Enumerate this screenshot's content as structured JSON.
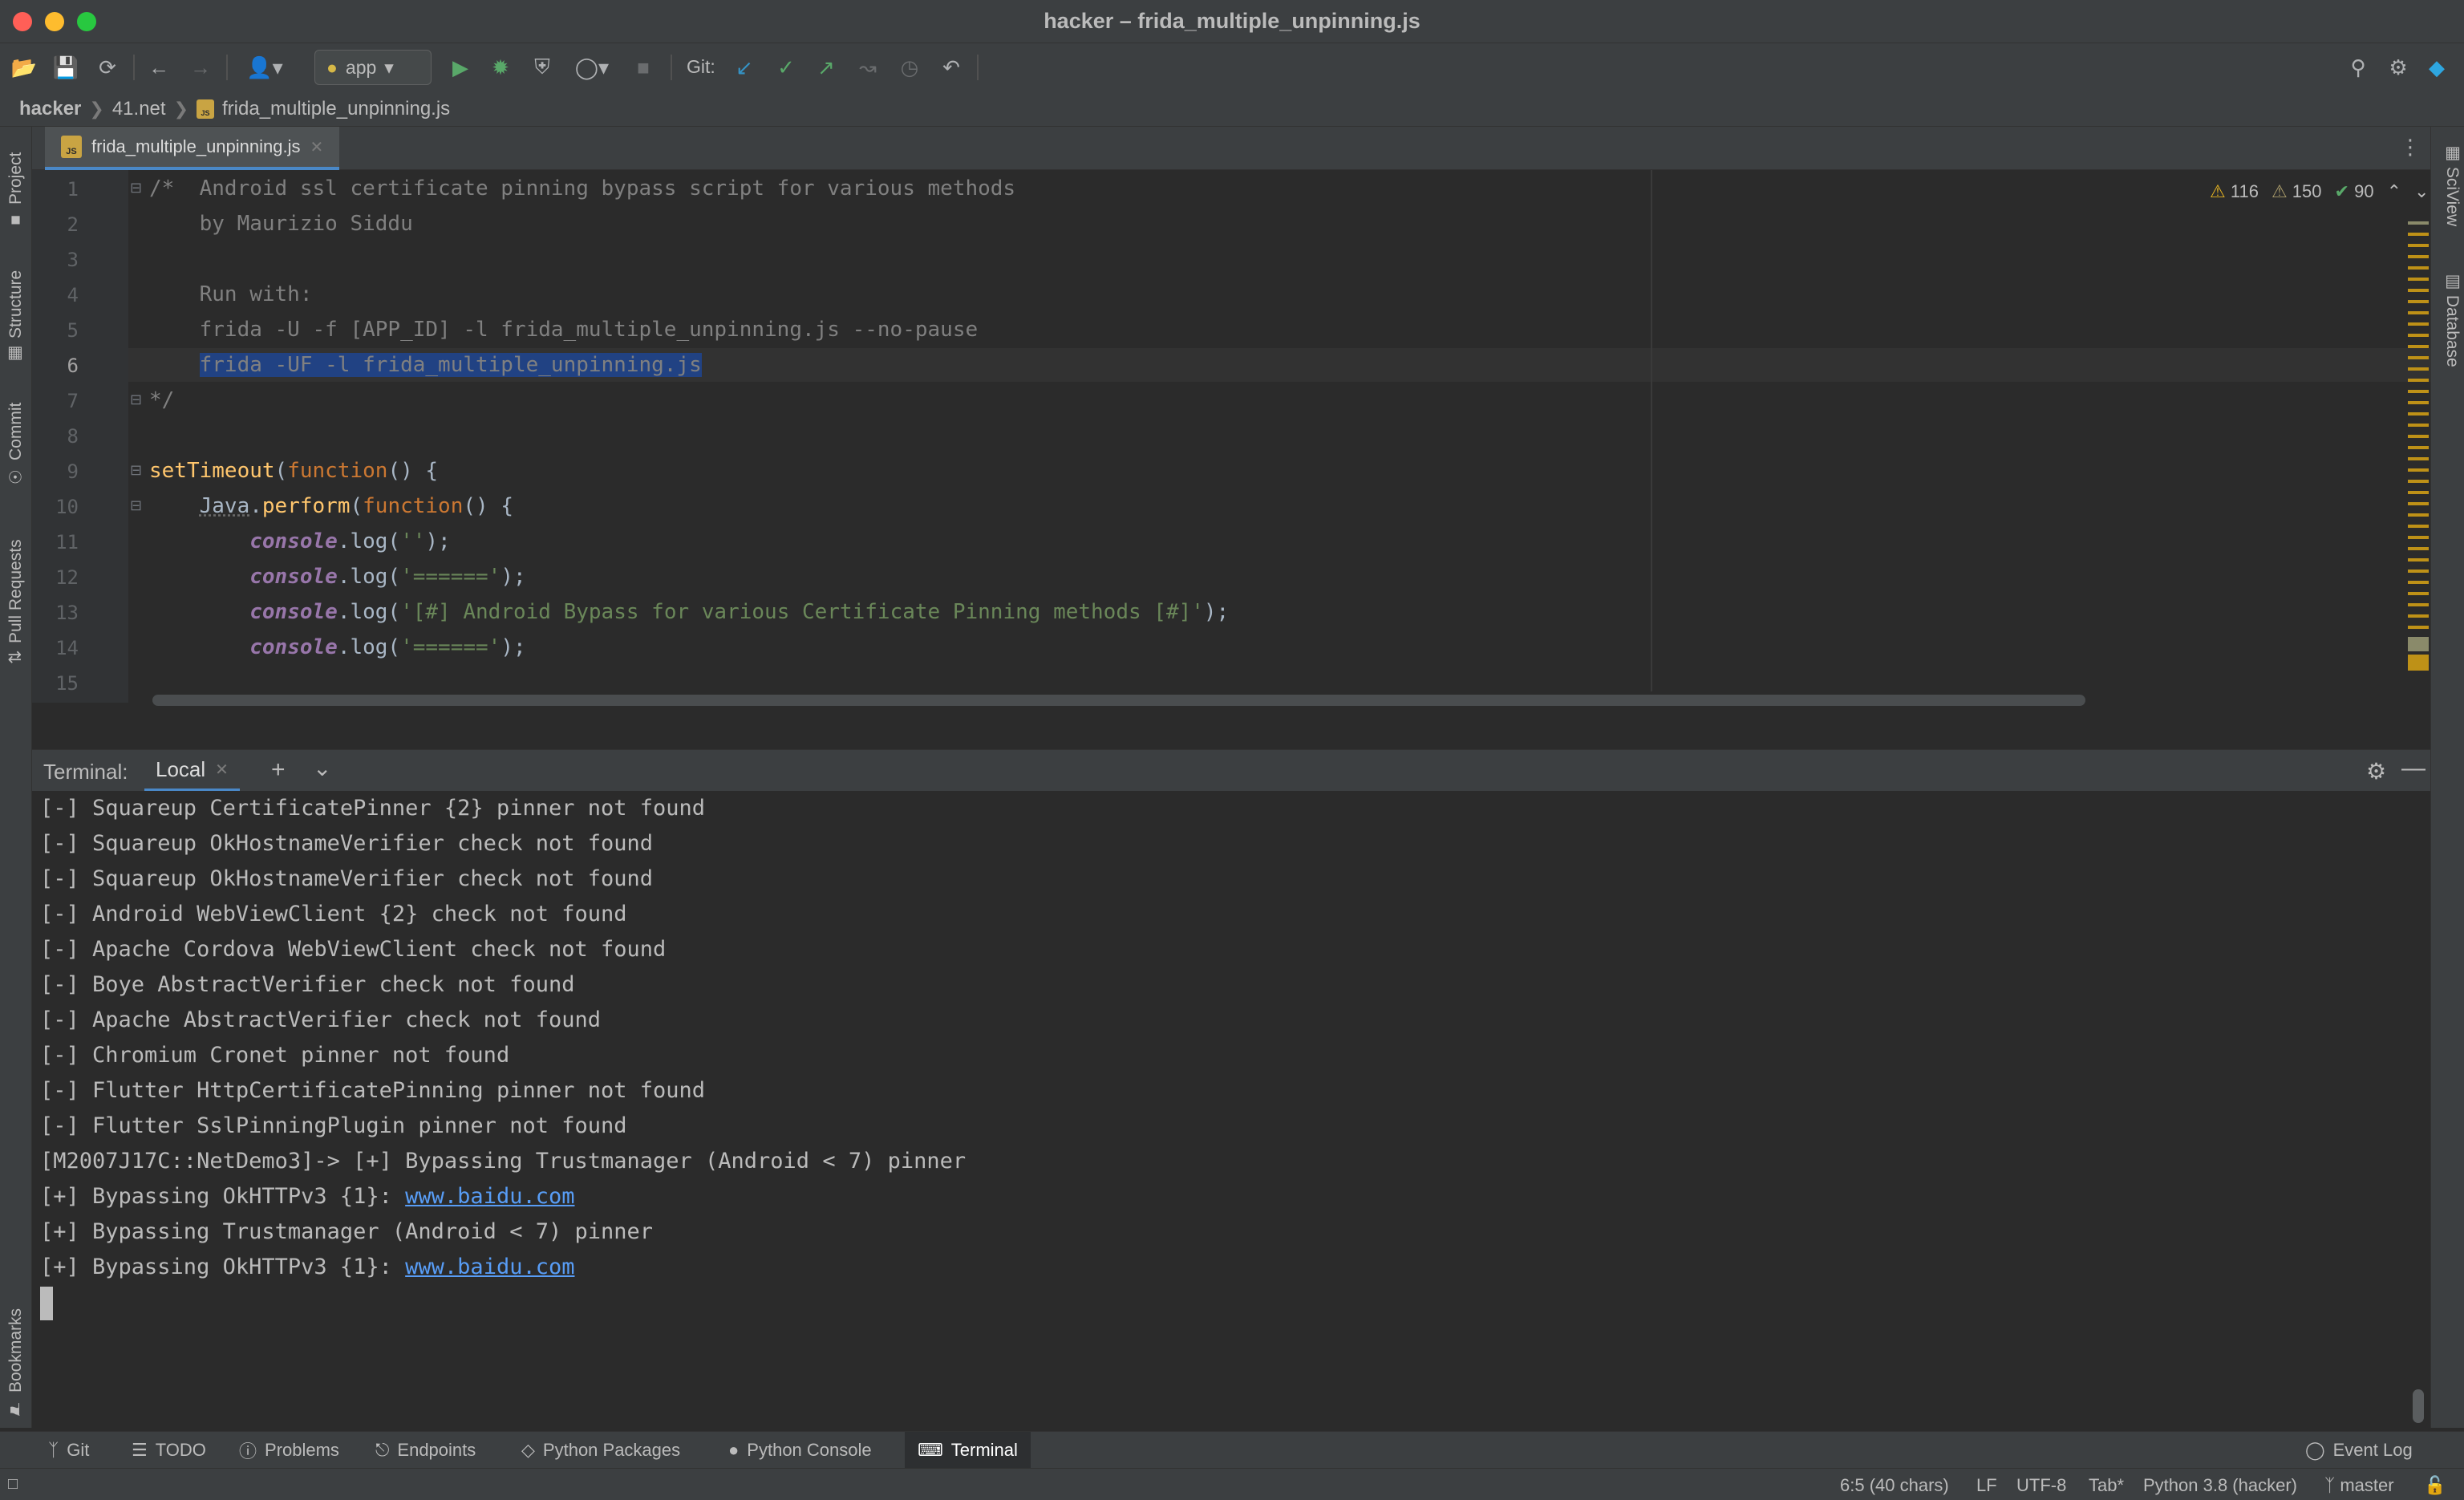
{
  "window": {
    "title": "hacker – frida_multiple_unpinning.js"
  },
  "toolbar": {
    "run_config": "app",
    "git_label": "Git:"
  },
  "breadcrumb": [
    "hacker",
    "41.net",
    "frida_multiple_unpinning.js"
  ],
  "left_tools": [
    "Project",
    "Structure",
    "Commit",
    "Pull Requests",
    "Bookmarks"
  ],
  "right_tools": [
    "SciView",
    "Database"
  ],
  "editor": {
    "tab": "frida_multiple_unpinning.js",
    "inspections": {
      "warnings": "116",
      "weak_warnings": "150",
      "ok": "90"
    },
    "line_numbers": [
      "1",
      "2",
      "3",
      "4",
      "5",
      "6",
      "7",
      "8",
      "9",
      "10",
      "11",
      "12",
      "13",
      "14",
      "15"
    ],
    "current_line": "6",
    "lines": {
      "l1": "/*  Android ssl certificate pinning bypass script for various methods",
      "l2": "    by Maurizio Siddu",
      "l4": "    Run with:",
      "l5": "    frida -U -f [APP_ID] -l frida_multiple_unpinning.js --no-pause",
      "l6_indent": "    ",
      "l6_sel": "frida -UF -l frida_multiple_unpinning.js",
      "l7": "*/",
      "l9_fn": "setTimeout",
      "l9_p1": "(",
      "l9_kw": "function",
      "l9_p2": "() {",
      "l10_indent": "    ",
      "l10_obj": "Java",
      "l10_dot": ".",
      "l10_fn": "perform",
      "l10_p1": "(",
      "l10_kw": "function",
      "l10_p2": "() {",
      "console_indent": "        ",
      "console": "console",
      "log_open": ".log(",
      "log_close": ");",
      "l11_str": "''",
      "l12_str": "'======'",
      "l13_str": "'[#] Android Bypass for various Certificate Pinning methods [#]'",
      "l14_str": "'======'"
    }
  },
  "terminal": {
    "label": "Terminal:",
    "tab": "Local",
    "lines": [
      "[-] Squareup CertificatePinner {2} pinner not found",
      "[-] Squareup OkHostnameVerifier check not found",
      "[-] Squareup OkHostnameVerifier check not found",
      "[-] Android WebViewClient {2} check not found",
      "[-] Apache Cordova WebViewClient check not found",
      "[-] Boye AbstractVerifier check not found",
      "[-] Apache AbstractVerifier check not found",
      "[-] Chromium Cronet pinner not found",
      "[-] Flutter HttpCertificatePinning pinner not found",
      "[-] Flutter SslPinningPlugin pinner not found",
      "[M2007J17C::NetDemo3]-> [+] Bypassing Trustmanager (Android < 7) pinner"
    ],
    "link_line_prefix": "[+] Bypassing OkHTTPv3 {1}: ",
    "link": "www.baidu.com",
    "line_trust": "[+] Bypassing Trustmanager (Android < 7) pinner"
  },
  "bottom_tabs": [
    "Git",
    "TODO",
    "Problems",
    "Endpoints",
    "Python Packages",
    "Python Console",
    "Terminal"
  ],
  "event_log": "Event Log",
  "status": {
    "position": "6:5 (40 chars)",
    "line_sep": "LF",
    "encoding": "UTF-8",
    "indent": "Tab*",
    "interpreter": "Python 3.8 (hacker)",
    "branch": "master"
  },
  "colors": {
    "accent": "#4a88c7",
    "warning": "#be9117",
    "selection": "#214283",
    "link": "#589df6"
  }
}
